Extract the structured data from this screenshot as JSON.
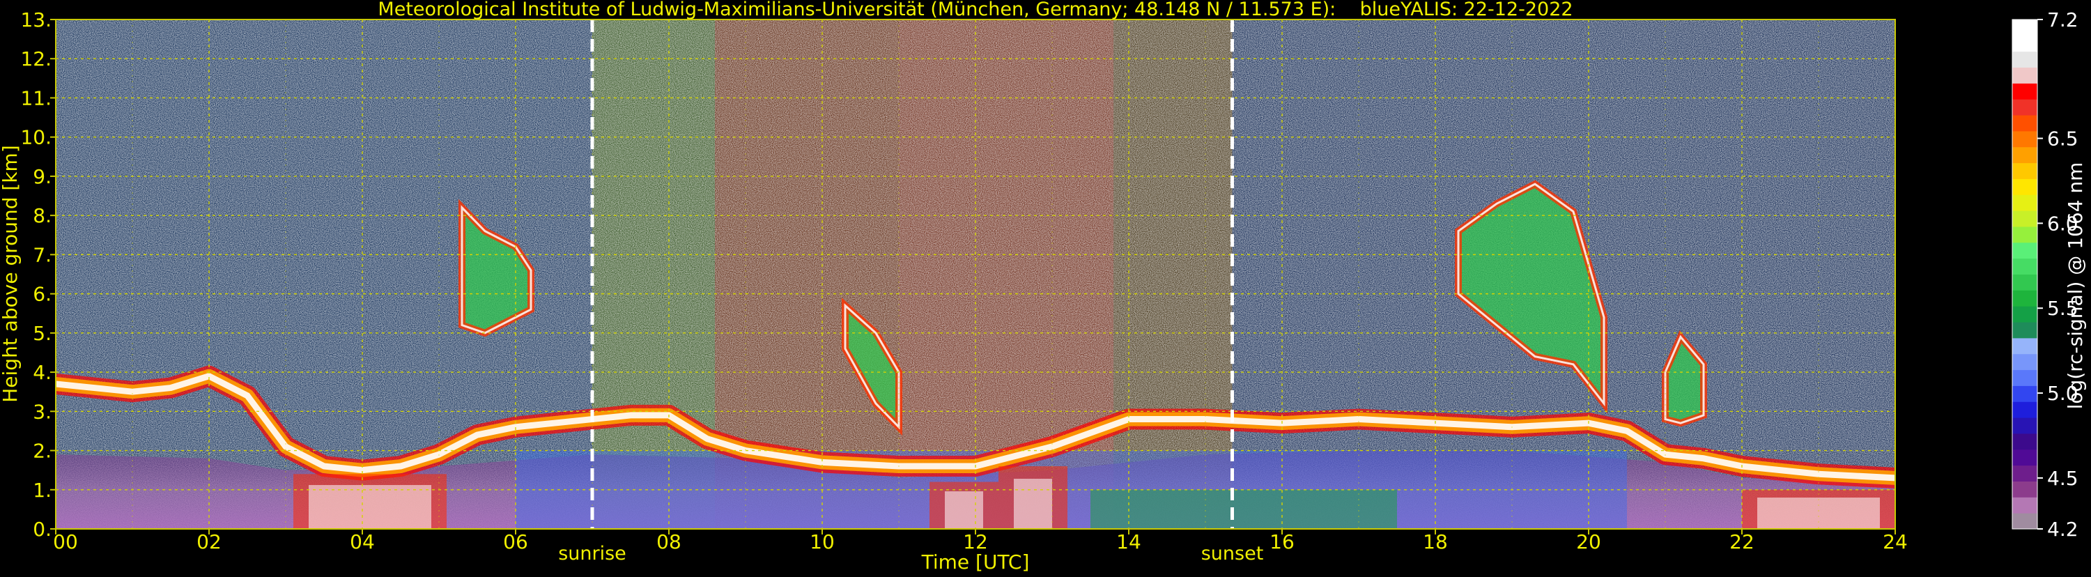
{
  "chart_data": {
    "type": "heatmap",
    "title": "Meteorological Institute of Ludwig-Maximilians-Universität (München, Germany; 48.148 N / 11.573 E):    blueYALIS: 22-12-2022",
    "xlabel": "Time [UTC]",
    "ylabel": "Height above ground [km]",
    "xlim": [
      0,
      24
    ],
    "ylim": [
      0,
      13
    ],
    "x_ticks": [
      {
        "value": 0,
        "label": "00"
      },
      {
        "value": 2,
        "label": "02"
      },
      {
        "value": 4,
        "label": "04"
      },
      {
        "value": 6,
        "label": "06"
      },
      {
        "value": 8,
        "label": "08"
      },
      {
        "value": 10,
        "label": "10"
      },
      {
        "value": 12,
        "label": "12"
      },
      {
        "value": 14,
        "label": "14"
      },
      {
        "value": 16,
        "label": "16"
      },
      {
        "value": 18,
        "label": "18"
      },
      {
        "value": 20,
        "label": "20"
      },
      {
        "value": 22,
        "label": "22"
      },
      {
        "value": 24,
        "label": "24"
      }
    ],
    "y_ticks": [
      {
        "value": 0,
        "label": "0."
      },
      {
        "value": 1,
        "label": "1."
      },
      {
        "value": 2,
        "label": "2."
      },
      {
        "value": 3,
        "label": "3."
      },
      {
        "value": 4,
        "label": "4."
      },
      {
        "value": 5,
        "label": "5."
      },
      {
        "value": 6,
        "label": "6."
      },
      {
        "value": 7,
        "label": "7."
      },
      {
        "value": 8,
        "label": "8."
      },
      {
        "value": 9,
        "label": "9."
      },
      {
        "value": 10,
        "label": "10."
      },
      {
        "value": 11,
        "label": "11."
      },
      {
        "value": 12,
        "label": "12."
      },
      {
        "value": 13,
        "label": "13."
      }
    ],
    "grid": true,
    "grid_color": "#d4d400",
    "markers": [
      {
        "time": 7.0,
        "label": "sunrise"
      },
      {
        "time": 15.35,
        "label": "sunset"
      }
    ],
    "colorbar": {
      "label": "log(rc-signal) @ 1064 nm",
      "range": [
        4.2,
        7.2
      ],
      "tick_labels": [
        {
          "value": 7.2,
          "label": "7.2"
        },
        {
          "value": 6.5,
          "label": "6.5"
        },
        {
          "value": 6.0,
          "label": "6.0"
        },
        {
          "value": 5.5,
          "label": "5.5"
        },
        {
          "value": 5.0,
          "label": "5.0"
        },
        {
          "value": 4.5,
          "label": "4.5"
        },
        {
          "value": 4.2,
          "label": "4.2"
        }
      ],
      "colors": [
        "#a08ca0",
        "#b478b4",
        "#8c3c8c",
        "#6e1e8c",
        "#500a96",
        "#3c0a8c",
        "#2814b4",
        "#1e1edc",
        "#3246f0",
        "#5a78fa",
        "#7896fa",
        "#96b4fa",
        "#1e8c5a",
        "#14a046",
        "#1eb43c",
        "#32c850",
        "#46dc64",
        "#5af078",
        "#96f03c",
        "#c8f028",
        "#e6f014",
        "#ffe600",
        "#ffc800",
        "#ffa000",
        "#ff7800",
        "#ff5000",
        "#f03228",
        "#ff0000",
        "#f0c8c8",
        "#e6e6e6",
        "#ffffff",
        "#ffffff"
      ]
    },
    "noise_background": [
      {
        "t0": 0,
        "t1": 7.0,
        "color": "#1e3f6b"
      },
      {
        "t0": 7.0,
        "t1": 8.6,
        "color": "#466a2c"
      },
      {
        "t0": 8.6,
        "t1": 11.0,
        "color": "#7a3a1c"
      },
      {
        "t0": 11.0,
        "t1": 13.8,
        "color": "#8a3a22"
      },
      {
        "t0": 13.8,
        "t1": 15.35,
        "color": "#5a4620"
      },
      {
        "t0": 15.35,
        "t1": 24,
        "color": "#1f3866"
      }
    ],
    "series": [
      {
        "feature": "low-level aerosol layer",
        "x": [
          0,
          2,
          3,
          5,
          7,
          9,
          11,
          13,
          15,
          17,
          19,
          21,
          22,
          24
        ],
        "y_top_km": [
          1.9,
          1.8,
          1.5,
          1.6,
          1.9,
          1.8,
          1.3,
          1.5,
          1.9,
          2.0,
          2.0,
          1.7,
          1.3,
          1.2
        ]
      },
      {
        "feature": "cloud layer top",
        "x": [
          0,
          0.5,
          1,
          1.5,
          2,
          2.5,
          3,
          3.5,
          4,
          4.5,
          5,
          5.5,
          6,
          6.5,
          7,
          7.5,
          8,
          8.5,
          9,
          10,
          11,
          12,
          13,
          14,
          15,
          16,
          17,
          18,
          19,
          20,
          20.5,
          21,
          21.5,
          22,
          23,
          24
        ],
        "y_km": [
          3.7,
          3.6,
          3.5,
          3.6,
          3.9,
          3.4,
          2.1,
          1.6,
          1.5,
          1.6,
          1.9,
          2.4,
          2.6,
          2.7,
          2.8,
          2.9,
          2.9,
          2.3,
          2.0,
          1.7,
          1.6,
          1.6,
          2.1,
          2.8,
          2.8,
          2.7,
          2.8,
          2.7,
          2.6,
          2.7,
          2.5,
          1.9,
          1.8,
          1.6,
          1.4,
          1.3
        ]
      },
      {
        "feature": "cirrus 05-06 UTC",
        "x": [
          5.3,
          5.6,
          6.0,
          6.2
        ],
        "y_top_km": [
          8.2,
          7.6,
          7.2,
          6.6
        ],
        "y_bottom_km": [
          5.2,
          5.0,
          5.4,
          5.6
        ]
      },
      {
        "feature": "cirrus 10-11 UTC",
        "x": [
          10.3,
          10.7,
          11.0
        ],
        "y_top_km": [
          5.7,
          5.0,
          4.0
        ],
        "y_bottom_km": [
          4.6,
          3.2,
          2.6
        ]
      },
      {
        "feature": "cirrus 18-20 UTC",
        "x": [
          18.3,
          18.8,
          19.3,
          19.8,
          20.2
        ],
        "y_top_km": [
          7.6,
          8.3,
          8.8,
          8.1,
          5.4
        ],
        "y_bottom_km": [
          6.0,
          5.2,
          4.4,
          4.2,
          3.2
        ]
      },
      {
        "feature": "cloud 21-21.5 UTC",
        "x": [
          21.0,
          21.2,
          21.5
        ],
        "y_top_km": [
          4.0,
          4.9,
          4.2
        ],
        "y_bottom_km": [
          2.8,
          2.7,
          2.9
        ]
      }
    ]
  }
}
